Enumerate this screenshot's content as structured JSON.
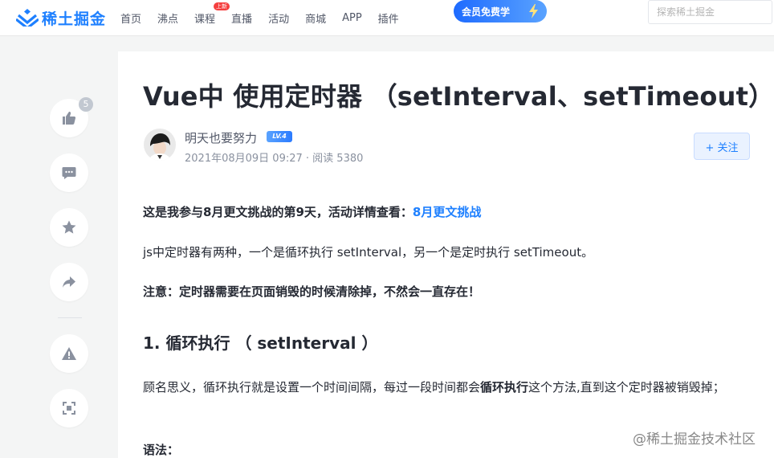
{
  "header": {
    "logo_text": "稀土掘金",
    "nav": [
      {
        "label": "首页"
      },
      {
        "label": "沸点"
      },
      {
        "label": "课程",
        "badge": "上新"
      },
      {
        "label": "直播"
      },
      {
        "label": "活动"
      },
      {
        "label": "商城"
      },
      {
        "label": "APP"
      },
      {
        "label": "插件"
      }
    ],
    "vip_label": "会员免费学",
    "search_placeholder": "探索稀土掘金"
  },
  "sidebar": {
    "like_count": "5",
    "icons": [
      "thumb-up-icon",
      "comment-icon",
      "star-icon",
      "share-icon",
      "warning-icon",
      "fullscreen-icon"
    ]
  },
  "article": {
    "title": "Vue中 使用定时器 （setInterval、setTimeout）",
    "author": {
      "name": "明天也要努力",
      "level": "LV.4"
    },
    "meta": "2021年08月09日 09:27 · 阅读 5380",
    "follow_label": "+ 关注",
    "intro_prefix": "这是我参与8月更文挑战的第9天，活动详情查看：",
    "intro_link": "8月更文挑战",
    "para1": "js中定时器有两种，一个是循环执行 setInterval，另一个是定时执行 setTimeout。",
    "note": "注意：定时器需要在页面销毁的时候清除掉，不然会一直存在！",
    "heading1": "1. 循环执行 （ setInterval ）",
    "para2_a": "顾名思义，循环执行就是设置一个时间间隔，每过一段时间都会",
    "para2_bold": "循环执行",
    "para2_b": "这个方法,直到这个定时器被销毁掉；",
    "next_label": "语法："
  },
  "watermark": "@稀土掘金技术社区",
  "colors": {
    "brand": "#1e80ff",
    "background": "#f4f5f5",
    "text": "#252933",
    "muted": "#8a919f"
  }
}
